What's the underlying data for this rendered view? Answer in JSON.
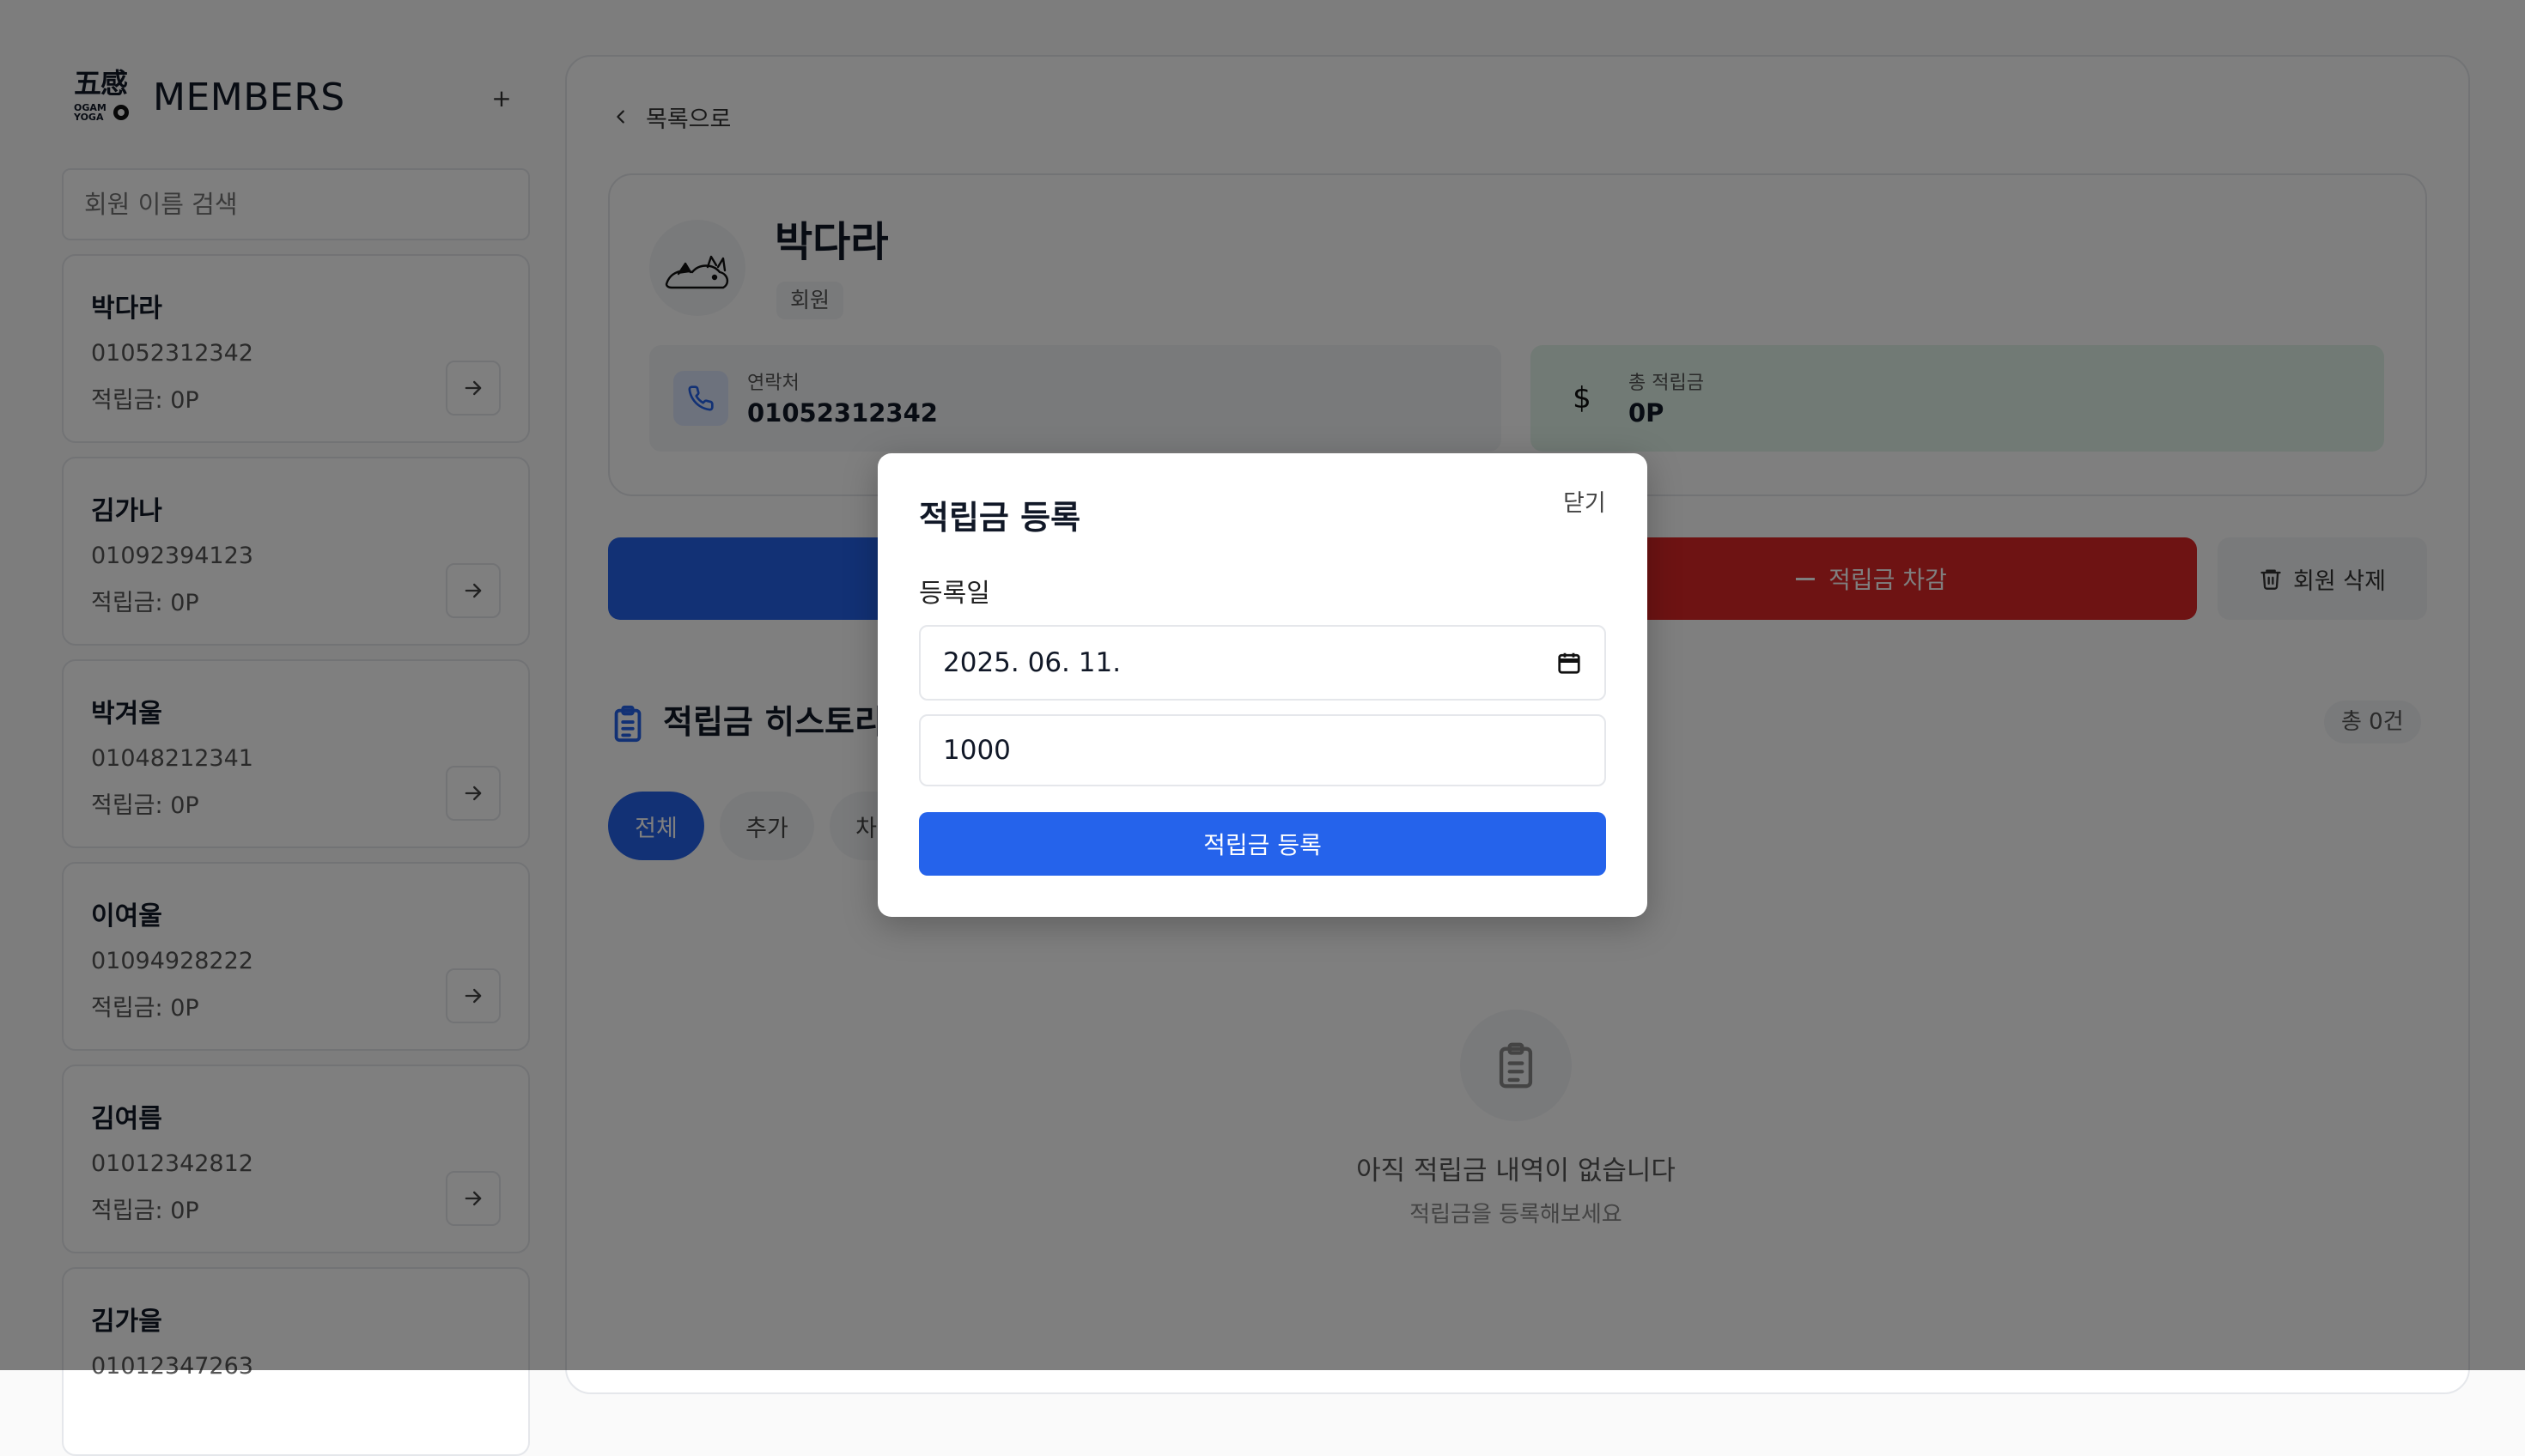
{
  "sidebar": {
    "logo_hanja": "五感",
    "logo_sub": "OGAM YOGA",
    "title": "MEMBERS",
    "add_label": "+",
    "search_placeholder": "회원 이름 검색",
    "members": [
      {
        "name": "박다라",
        "phone": "01052312342",
        "points": "적립금: 0P"
      },
      {
        "name": "김가나",
        "phone": "01092394123",
        "points": "적립금: 0P"
      },
      {
        "name": "박겨울",
        "phone": "01048212341",
        "points": "적립금: 0P"
      },
      {
        "name": "이여울",
        "phone": "01094928222",
        "points": "적립금: 0P"
      },
      {
        "name": "김여름",
        "phone": "01012342812",
        "points": "적립금: 0P"
      },
      {
        "name": "김가을",
        "phone": "01012347263",
        "points": ""
      }
    ]
  },
  "main": {
    "back_label": "목록으로",
    "profile": {
      "name": "박다라",
      "role": "회원",
      "contact_label": "연락처",
      "contact_value": "01052312342",
      "total_label": "총 적립금",
      "total_value": "0P"
    },
    "actions": {
      "deduct_label": "적립금 차감",
      "delete_label": "회원 삭제"
    },
    "history": {
      "title": "적립금 히스토리",
      "count": "총 0건",
      "filters": [
        "전체",
        "추가",
        "차감"
      ],
      "empty_title": "아직 적립금 내역이 없습니다",
      "empty_sub": "적립금을 등록해보세요"
    }
  },
  "modal": {
    "title": "적립금 등록",
    "close_label": "닫기",
    "date_label": "등록일",
    "date_value": "2025. 06. 11.",
    "amount_value": "1000",
    "submit_label": "적립금 등록"
  },
  "colors": {
    "primary": "#2563eb",
    "danger": "#dc2626",
    "contact_bg": "#f3f4f6",
    "points_bg": "#e3f5ea"
  }
}
